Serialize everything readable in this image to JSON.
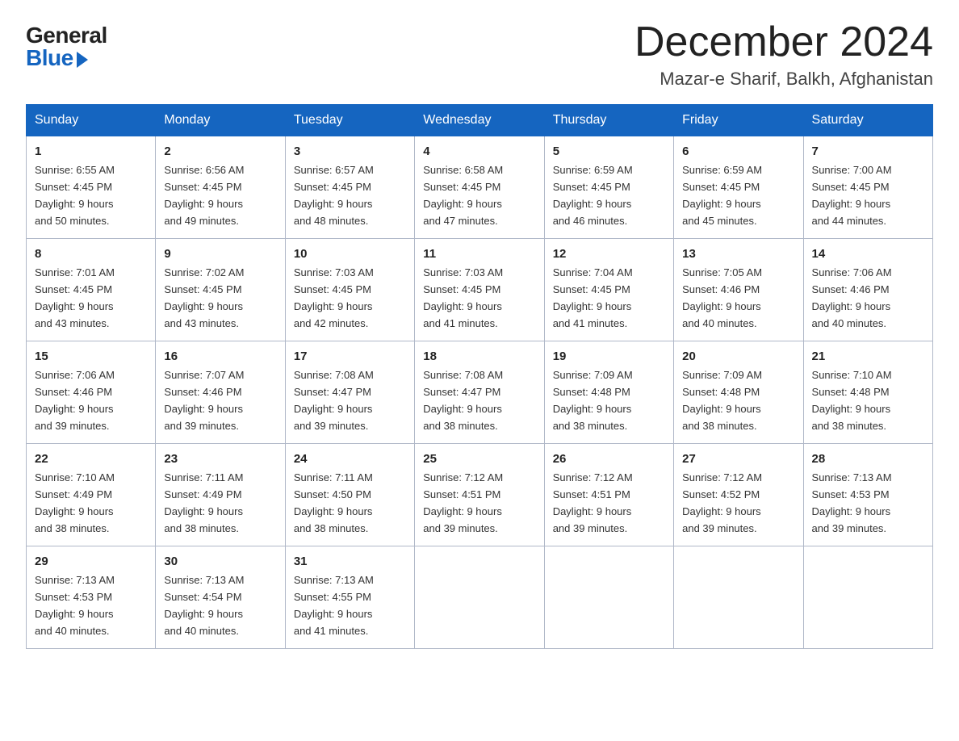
{
  "logo": {
    "general": "General",
    "blue": "Blue"
  },
  "title": "December 2024",
  "subtitle": "Mazar-e Sharif, Balkh, Afghanistan",
  "days_of_week": [
    "Sunday",
    "Monday",
    "Tuesday",
    "Wednesday",
    "Thursday",
    "Friday",
    "Saturday"
  ],
  "weeks": [
    [
      {
        "day": "1",
        "sunrise": "6:55 AM",
        "sunset": "4:45 PM",
        "daylight": "9 hours and 50 minutes."
      },
      {
        "day": "2",
        "sunrise": "6:56 AM",
        "sunset": "4:45 PM",
        "daylight": "9 hours and 49 minutes."
      },
      {
        "day": "3",
        "sunrise": "6:57 AM",
        "sunset": "4:45 PM",
        "daylight": "9 hours and 48 minutes."
      },
      {
        "day": "4",
        "sunrise": "6:58 AM",
        "sunset": "4:45 PM",
        "daylight": "9 hours and 47 minutes."
      },
      {
        "day": "5",
        "sunrise": "6:59 AM",
        "sunset": "4:45 PM",
        "daylight": "9 hours and 46 minutes."
      },
      {
        "day": "6",
        "sunrise": "6:59 AM",
        "sunset": "4:45 PM",
        "daylight": "9 hours and 45 minutes."
      },
      {
        "day": "7",
        "sunrise": "7:00 AM",
        "sunset": "4:45 PM",
        "daylight": "9 hours and 44 minutes."
      }
    ],
    [
      {
        "day": "8",
        "sunrise": "7:01 AM",
        "sunset": "4:45 PM",
        "daylight": "9 hours and 43 minutes."
      },
      {
        "day": "9",
        "sunrise": "7:02 AM",
        "sunset": "4:45 PM",
        "daylight": "9 hours and 43 minutes."
      },
      {
        "day": "10",
        "sunrise": "7:03 AM",
        "sunset": "4:45 PM",
        "daylight": "9 hours and 42 minutes."
      },
      {
        "day": "11",
        "sunrise": "7:03 AM",
        "sunset": "4:45 PM",
        "daylight": "9 hours and 41 minutes."
      },
      {
        "day": "12",
        "sunrise": "7:04 AM",
        "sunset": "4:45 PM",
        "daylight": "9 hours and 41 minutes."
      },
      {
        "day": "13",
        "sunrise": "7:05 AM",
        "sunset": "4:46 PM",
        "daylight": "9 hours and 40 minutes."
      },
      {
        "day": "14",
        "sunrise": "7:06 AM",
        "sunset": "4:46 PM",
        "daylight": "9 hours and 40 minutes."
      }
    ],
    [
      {
        "day": "15",
        "sunrise": "7:06 AM",
        "sunset": "4:46 PM",
        "daylight": "9 hours and 39 minutes."
      },
      {
        "day": "16",
        "sunrise": "7:07 AM",
        "sunset": "4:46 PM",
        "daylight": "9 hours and 39 minutes."
      },
      {
        "day": "17",
        "sunrise": "7:08 AM",
        "sunset": "4:47 PM",
        "daylight": "9 hours and 39 minutes."
      },
      {
        "day": "18",
        "sunrise": "7:08 AM",
        "sunset": "4:47 PM",
        "daylight": "9 hours and 38 minutes."
      },
      {
        "day": "19",
        "sunrise": "7:09 AM",
        "sunset": "4:48 PM",
        "daylight": "9 hours and 38 minutes."
      },
      {
        "day": "20",
        "sunrise": "7:09 AM",
        "sunset": "4:48 PM",
        "daylight": "9 hours and 38 minutes."
      },
      {
        "day": "21",
        "sunrise": "7:10 AM",
        "sunset": "4:48 PM",
        "daylight": "9 hours and 38 minutes."
      }
    ],
    [
      {
        "day": "22",
        "sunrise": "7:10 AM",
        "sunset": "4:49 PM",
        "daylight": "9 hours and 38 minutes."
      },
      {
        "day": "23",
        "sunrise": "7:11 AM",
        "sunset": "4:49 PM",
        "daylight": "9 hours and 38 minutes."
      },
      {
        "day": "24",
        "sunrise": "7:11 AM",
        "sunset": "4:50 PM",
        "daylight": "9 hours and 38 minutes."
      },
      {
        "day": "25",
        "sunrise": "7:12 AM",
        "sunset": "4:51 PM",
        "daylight": "9 hours and 39 minutes."
      },
      {
        "day": "26",
        "sunrise": "7:12 AM",
        "sunset": "4:51 PM",
        "daylight": "9 hours and 39 minutes."
      },
      {
        "day": "27",
        "sunrise": "7:12 AM",
        "sunset": "4:52 PM",
        "daylight": "9 hours and 39 minutes."
      },
      {
        "day": "28",
        "sunrise": "7:13 AM",
        "sunset": "4:53 PM",
        "daylight": "9 hours and 39 minutes."
      }
    ],
    [
      {
        "day": "29",
        "sunrise": "7:13 AM",
        "sunset": "4:53 PM",
        "daylight": "9 hours and 40 minutes."
      },
      {
        "day": "30",
        "sunrise": "7:13 AM",
        "sunset": "4:54 PM",
        "daylight": "9 hours and 40 minutes."
      },
      {
        "day": "31",
        "sunrise": "7:13 AM",
        "sunset": "4:55 PM",
        "daylight": "9 hours and 41 minutes."
      },
      null,
      null,
      null,
      null
    ]
  ],
  "labels": {
    "sunrise": "Sunrise:",
    "sunset": "Sunset:",
    "daylight": "Daylight:"
  }
}
